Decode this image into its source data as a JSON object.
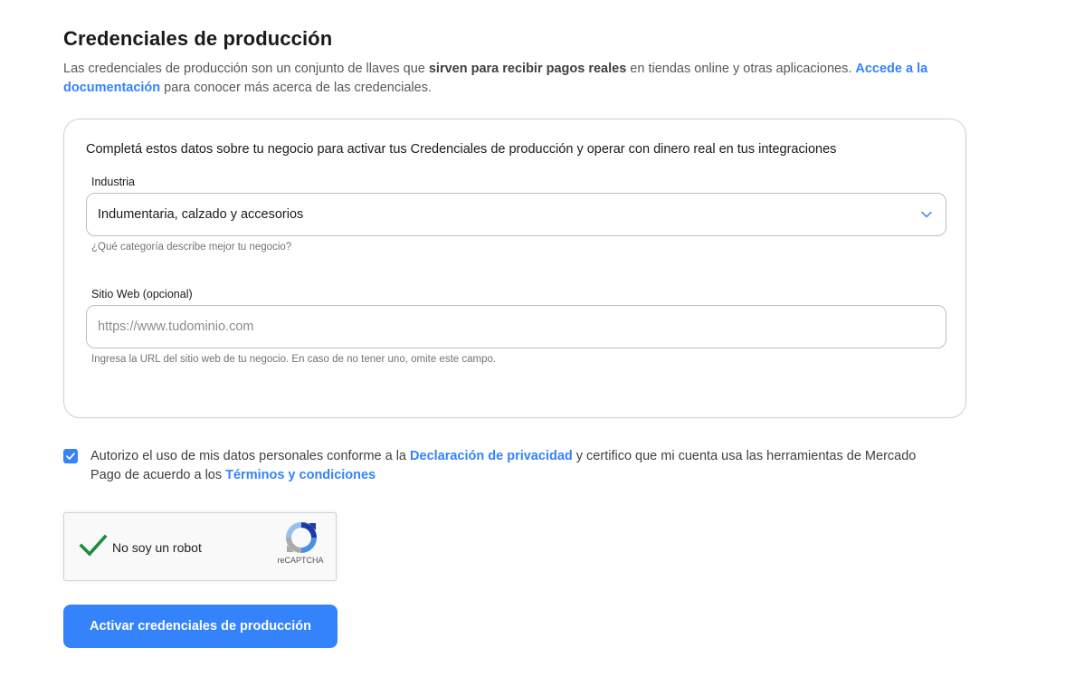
{
  "header": {
    "title": "Credenciales de producción",
    "description": {
      "part1": "Las credenciales de producción son un conjunto de llaves que ",
      "bold": "sirven para recibir pagos reales",
      "part2": " en tiendas online y otras aplicaciones. ",
      "link": "Accede a la documentación",
      "part3": " para conocer más acerca de las credenciales."
    }
  },
  "form": {
    "intro": "Completá estos datos sobre tu negocio para activar tus Credenciales de producción y operar con dinero real en tus integraciones",
    "industry": {
      "label": "Industria",
      "value": "Indumentaria, calzado y accesorios",
      "helper": "¿Qué categoría describe mejor tu negocio?"
    },
    "website": {
      "label": "Sitio Web (opcional)",
      "value": "",
      "placeholder": "https://www.tudominio.com",
      "helper": "Ingresa la URL del sitio web de tu negocio. En caso de no tener uno, omite este campo."
    }
  },
  "consent": {
    "checked": true,
    "part1": "Autorizo el uso de mis datos personales conforme a la ",
    "privacy_link": "Declaración de privacidad",
    "part2": " y certifico que mi cuenta usa las herramientas de Mercado Pago de acuerdo a los ",
    "terms_link": "Términos y condiciones"
  },
  "captcha": {
    "label": "No soy un robot",
    "brand": "reCAPTCHA",
    "checked": true
  },
  "actions": {
    "submit_label": "Activar credenciales de producción"
  },
  "icons": {
    "chevron": "chevron-down-icon",
    "checkbox_check": "check-icon",
    "captcha_check": "check-icon",
    "captcha_logo": "recaptcha-logo-icon"
  },
  "colors": {
    "accent": "#3483fa",
    "text": "#1a1a1a",
    "muted": "#595959",
    "border": "#bfbfbf",
    "captcha_check": "#1e8e3e"
  }
}
